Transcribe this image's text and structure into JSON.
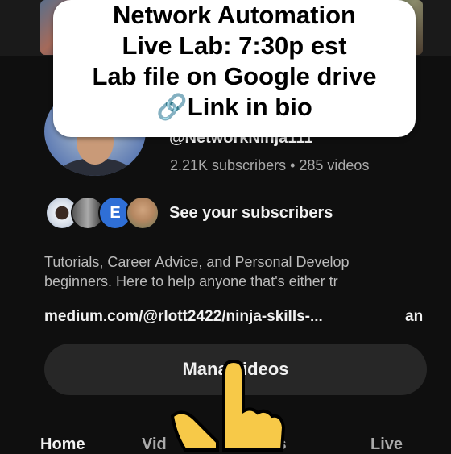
{
  "overlay": {
    "line1": "Network Automation",
    "line2": "Live Lab: 7:30p est",
    "line3": "Lab file on Google drive",
    "line4": "🔗Link in bio"
  },
  "channel": {
    "handle": "@NetworkNinja111",
    "stats": "2.21K subscribers • 285 videos"
  },
  "subscribers": {
    "label": "See your subscribers",
    "avatar_letter": "E"
  },
  "description": {
    "line1": "Tutorials, Career Advice, and Personal Develop",
    "line2": "beginners. Here to help anyone that's either tr"
  },
  "links": {
    "url": "medium.com/@rlott2422/ninja-skills-...",
    "more": "an"
  },
  "manage_button": {
    "label": "Mana    videos"
  },
  "tabs": [
    {
      "label": "Home"
    },
    {
      "label": "Vid"
    },
    {
      "label": "rts"
    },
    {
      "label": "Live"
    }
  ],
  "colors": {
    "background": "#0f0f0f",
    "button_bg": "#272727",
    "secondary_text": "#aaaaaa",
    "avatar_blue": "#2f6fd6",
    "hand_yellow": "#f7c948"
  },
  "icons": {
    "link": "link-icon",
    "pointer": "pointing-hand-icon"
  }
}
